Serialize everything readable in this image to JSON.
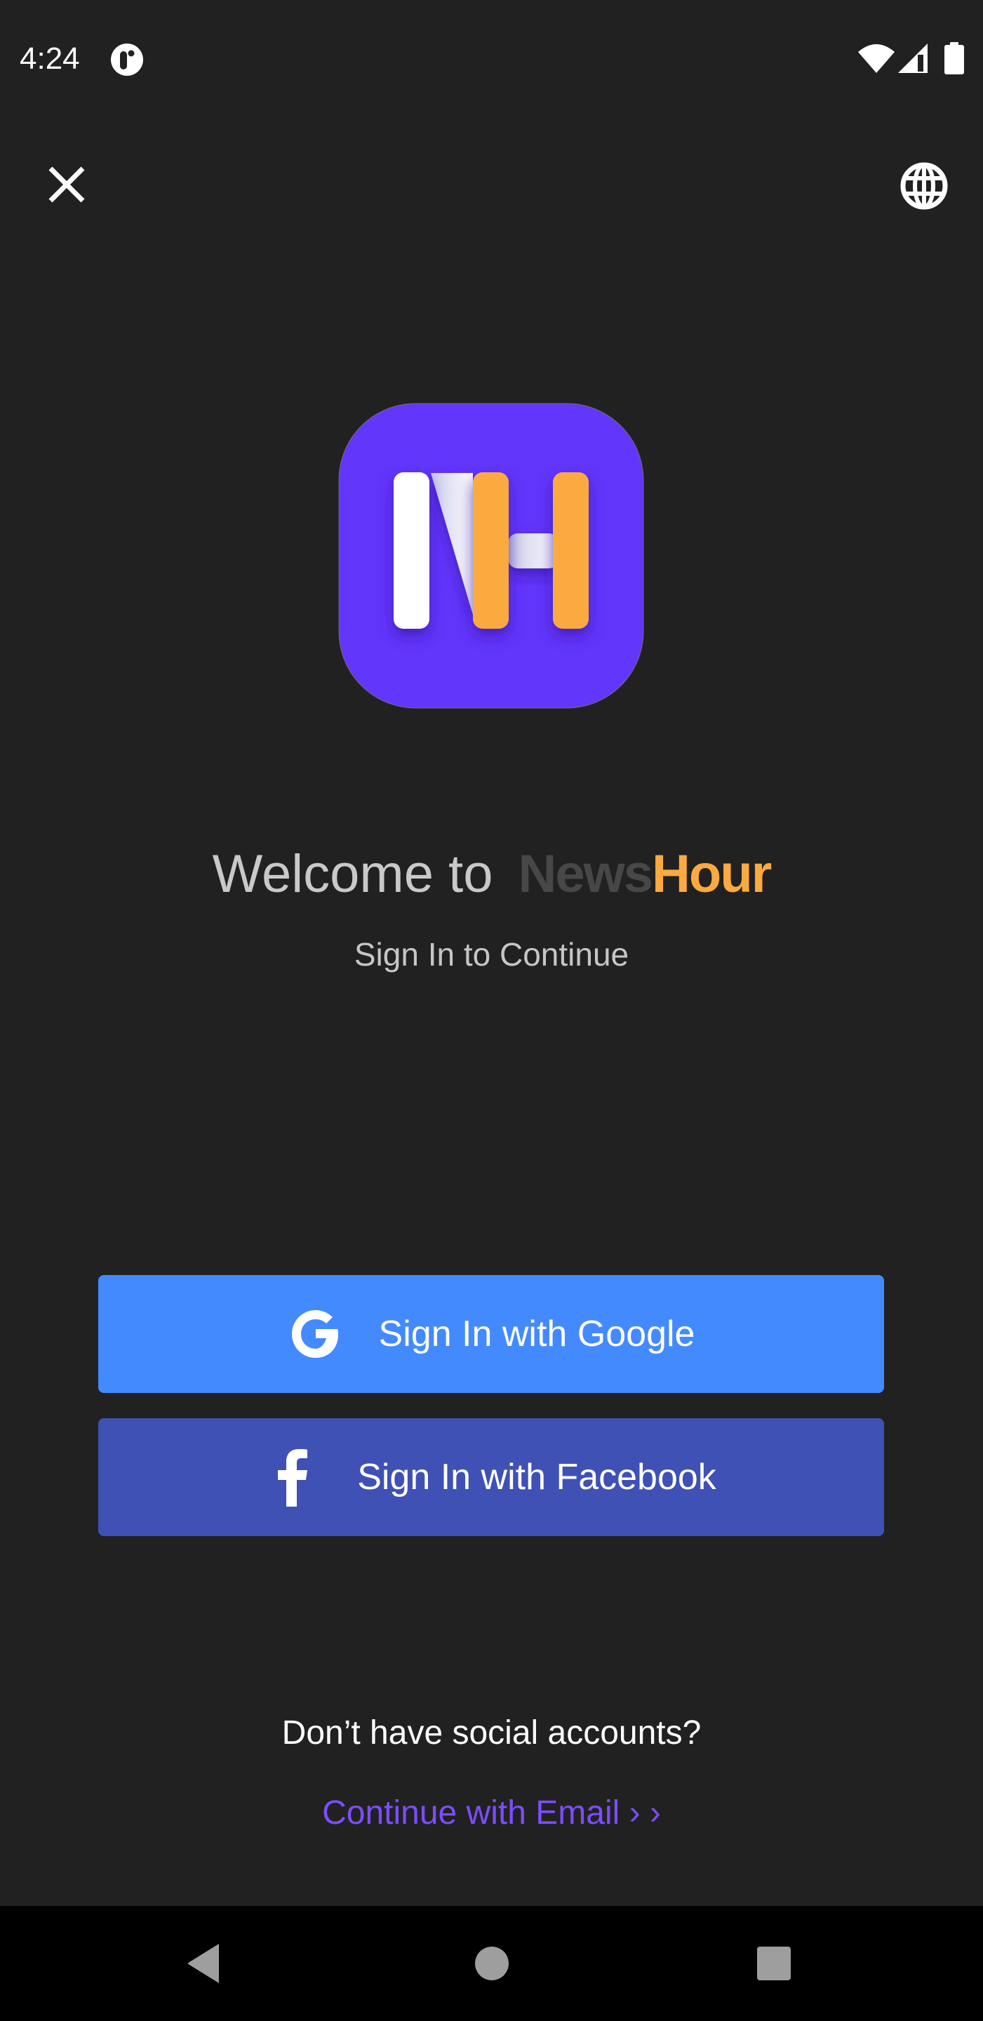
{
  "status_bar": {
    "time": "4:24",
    "icons": [
      "app-notification-icon",
      "wifi-icon",
      "cell-signal-icon",
      "battery-icon"
    ]
  },
  "top_bar": {
    "close_icon": "close-icon",
    "language_icon": "globe-icon"
  },
  "logo": {
    "letters": "NH",
    "background_color": "#6236fb",
    "accent_color": "#fbaa3f"
  },
  "welcome": {
    "prefix": "Welcome to",
    "brand_part1": "News",
    "brand_part2": "Hour",
    "subtitle": "Sign In to Continue"
  },
  "buttons": {
    "google": {
      "label": "Sign In with Google",
      "icon": "google-g-icon",
      "color": "#448aff"
    },
    "facebook": {
      "label": "Sign In with Facebook",
      "icon": "facebook-f-icon",
      "color": "#3f51b5"
    }
  },
  "footer": {
    "question": "Don’t have social accounts?",
    "email_link": "Continue with Email › ›",
    "link_color": "#7c4dff"
  },
  "nav_bar": {
    "buttons": [
      "back",
      "home",
      "recents"
    ]
  }
}
